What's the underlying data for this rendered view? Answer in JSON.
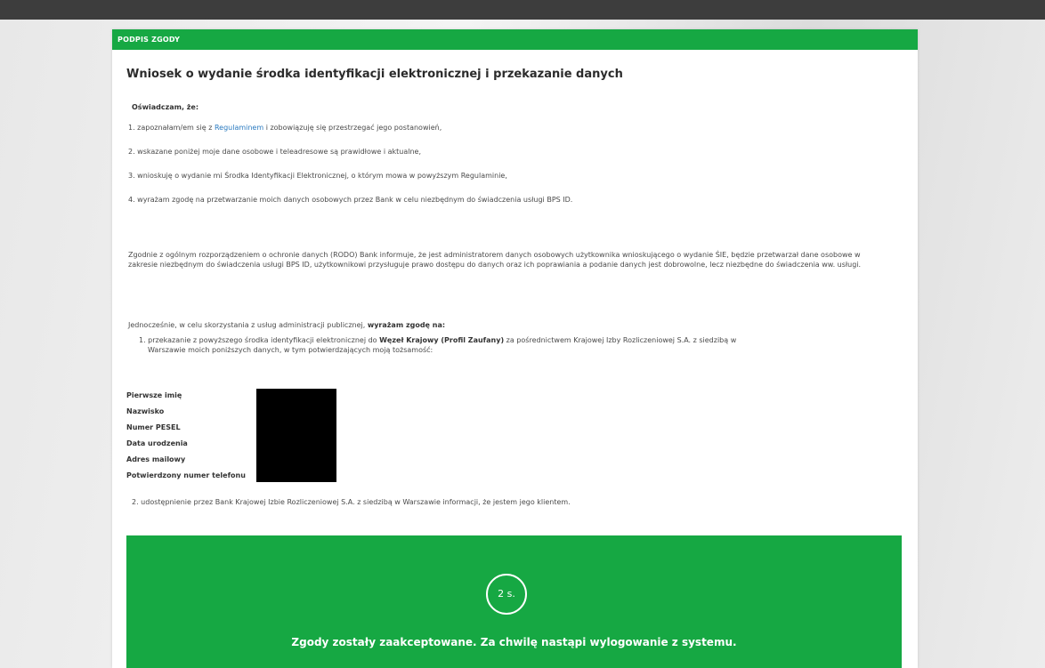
{
  "panel": {
    "header": "PODPIS ZGODY",
    "title": "Wniosek o wydanie środka identyfikacji elektronicznej i przekazanie danych"
  },
  "declaration": {
    "heading": "Oświadczam, że:",
    "item1_prefix": "1. zapoznałam/em się z ",
    "item1_link": "Regulaminem",
    "item1_suffix": " i zobowiązuję się przestrzegać jego postanowień,",
    "item2": "2. wskazane poniżej moje dane osobowe i teleadresowe są prawidłowe i aktualne,",
    "item3": "3. wnioskuję o wydanie mi Środka Identyfikacji Elektronicznej, o którym mowa w powyższym Regulaminie,",
    "item4": "4. wyrażam zgodę na przetwarzanie moich danych osobowych przez Bank w celu niezbędnym do świadczenia usługi BPS ID."
  },
  "rodo": {
    "text": "Zgodnie z ogólnym rozporządzeniem o ochronie danych (RODO) Bank informuje, że jest administratorem danych osobowych użytkownika wnioskującego o wydanie ŚIE, będzie przetwarzał dane osobowe w zakresie niezbędnym do świadczenia usługi BPS ID, użytkownikowi przysługuje prawo dostępu do danych oraz ich poprawiania a podanie danych jest dobrowolne, lecz niezbędne do świadczenia ww. usługi."
  },
  "consent": {
    "intro_prefix": "Jednocześnie, w celu skorzystania z usług administracji publicznej, ",
    "intro_bold": "wyrażam zgodę na:",
    "item1_prefix": "1. przekazanie z powyższego środka identyfikacji elektronicznej do ",
    "item1_bold": "Węzeł Krajowy (Profil Zaufany)",
    "item1_suffix": " za pośrednictwem Krajowej Izby Rozliczeniowej S.A. z siedzibą w",
    "item1_line2": "Warszawie moich poniższych danych, w tym potwierdzających moją tożsamość:",
    "item2": "2. udostępnienie przez Bank Krajowej Izbie Rozliczeniowej S.A. z siedzibą w Warszawie informacji, że jestem jego klientem."
  },
  "fields": [
    {
      "label": "Pierwsze imię"
    },
    {
      "label": "Nazwisko"
    },
    {
      "label": "Numer PESEL"
    },
    {
      "label": "Data urodzenia"
    },
    {
      "label": "Adres mailowy"
    },
    {
      "label": "Potwierdzony numer telefonu"
    }
  ],
  "success": {
    "countdown": "2 s.",
    "message": "Zgody zostały zaakceptowane. Za chwilę nastąpi wylogowanie z systemu."
  },
  "colors": {
    "accent": "#16a843",
    "link": "#2a7ac0"
  }
}
